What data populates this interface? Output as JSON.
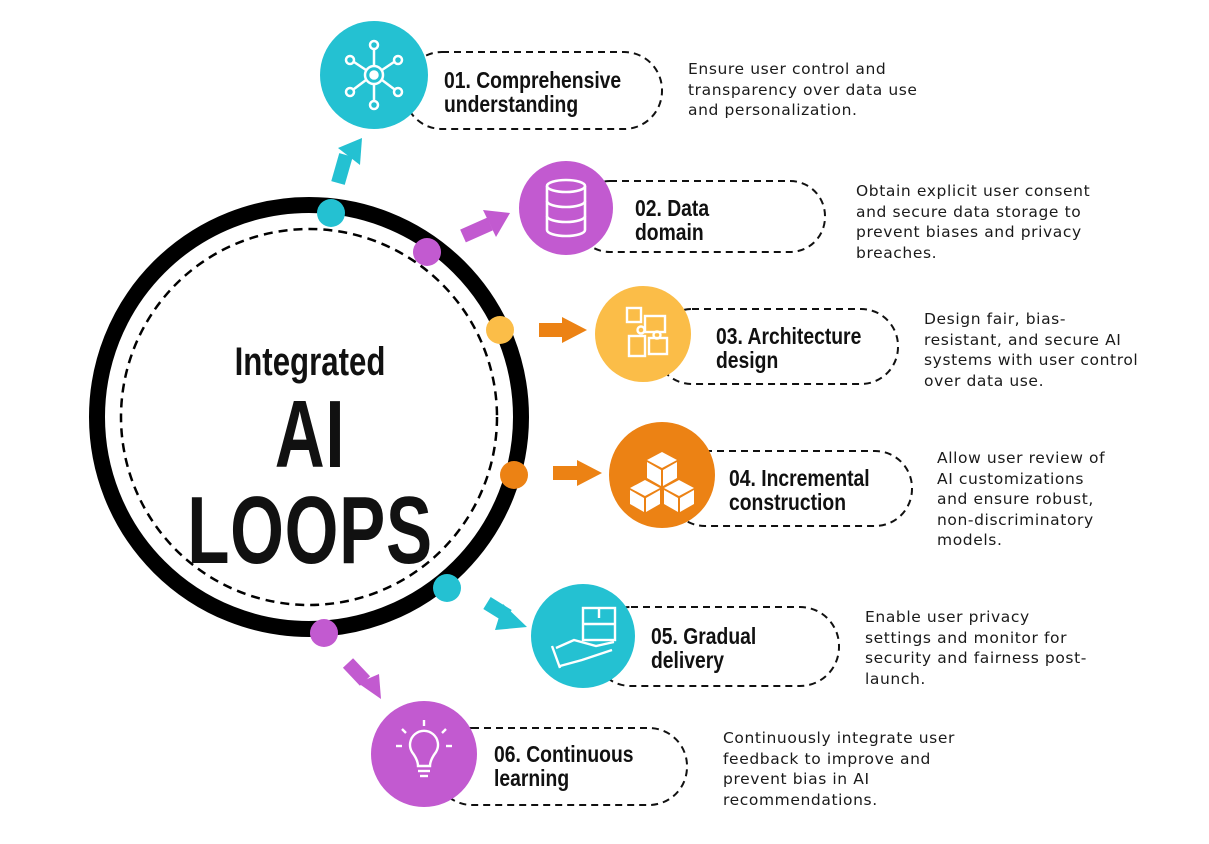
{
  "center": {
    "subtitle": "Integrated",
    "title": "AI LOOPS"
  },
  "colors": {
    "cyan": "#24c1d2",
    "purple": "#c25ad0",
    "yellow": "#fbbd48",
    "orange": "#ec8214",
    "ring": "#000000"
  },
  "steps": [
    {
      "title_lines": [
        "01. Comprehensive",
        "understanding"
      ],
      "desc_lines": [
        "Ensure user control and",
        "transparency over data use",
        "and personalization."
      ],
      "icon": "network-hub-icon",
      "color": "#24c1d2"
    },
    {
      "title_lines": [
        "02. Data",
        "domain"
      ],
      "desc_lines": [
        "Obtain explicit user consent",
        "and secure data storage to",
        "prevent biases and privacy",
        "breaches."
      ],
      "icon": "database-icon",
      "color": "#c25ad0"
    },
    {
      "title_lines": [
        "03. Architecture",
        "design"
      ],
      "desc_lines": [
        "Design fair, bias-",
        "resistant, and secure AI",
        "systems with user control",
        "over data use."
      ],
      "icon": "puzzle-icon",
      "color": "#fbbd48"
    },
    {
      "title_lines": [
        "04. Incremental",
        "construction"
      ],
      "desc_lines": [
        "Allow user review of",
        "AI customizations",
        "and ensure robust,",
        "non-discriminatory",
        "models."
      ],
      "icon": "stacked-boxes-icon",
      "color": "#ec8214"
    },
    {
      "title_lines": [
        "05. Gradual",
        "delivery"
      ],
      "desc_lines": [
        "Enable user privacy",
        "settings and monitor for",
        "security and fairness post-",
        "launch."
      ],
      "icon": "package-hand-icon",
      "color": "#24c1d2"
    },
    {
      "title_lines": [
        "06. Continuous",
        "learning"
      ],
      "desc_lines": [
        "Continuously integrate user",
        "feedback to improve and",
        "prevent bias in AI",
        "recommendations."
      ],
      "icon": "lightbulb-icon",
      "color": "#c25ad0"
    }
  ]
}
